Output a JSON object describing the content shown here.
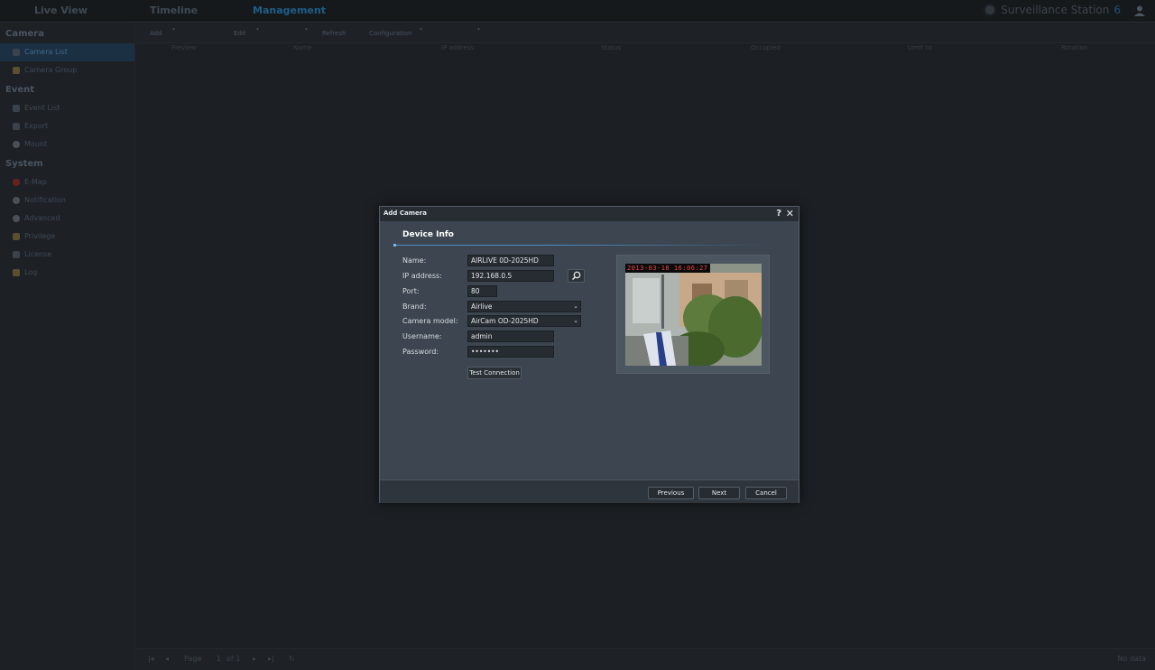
{
  "topbar": {
    "tabs": [
      "Live View",
      "Timeline",
      "Management"
    ],
    "brand_name": "Surveillance Station",
    "brand_version": "6"
  },
  "sidebar": {
    "sections": [
      {
        "title": "Camera",
        "items": [
          "Camera List",
          "Camera Group"
        ]
      },
      {
        "title": "Event",
        "items": [
          "Event List",
          "Export",
          "Mount"
        ]
      },
      {
        "title": "System",
        "items": [
          "E-Map",
          "Notification",
          "Advanced",
          "Privilege",
          "License",
          "Log"
        ]
      }
    ]
  },
  "toolbar": {
    "add": "Add",
    "edit": "Edit",
    "refresh": "Refresh",
    "configuration": "Configuration"
  },
  "columns": [
    "Preview",
    "Name",
    "IP address",
    "Status",
    "Occupied",
    "Limit to",
    "Rotation"
  ],
  "pager": {
    "page_label": "Page",
    "page_value": "1",
    "of_label": "of 1",
    "status": "No data"
  },
  "dialog": {
    "title": "Add Camera",
    "help": "?",
    "close": "✕",
    "tab": "Device Info",
    "labels": {
      "name": "Name:",
      "ip": "IP address:",
      "port": "Port:",
      "brand": "Brand:",
      "model": "Camera model:",
      "username": "Username:",
      "password": "Password:"
    },
    "values": {
      "name": "AIRLIVE 0D-2025HD",
      "ip": "192.168.0.5",
      "port": "80",
      "brand": "Airlive",
      "model": "AirCam OD-2025HD",
      "username": "admin",
      "password": "•••••••"
    },
    "test_connection": "Test Connection",
    "preview_timestamp": "2013-03-18 16:06:27",
    "buttons": {
      "previous": "Previous",
      "next": "Next",
      "cancel": "Cancel"
    }
  }
}
